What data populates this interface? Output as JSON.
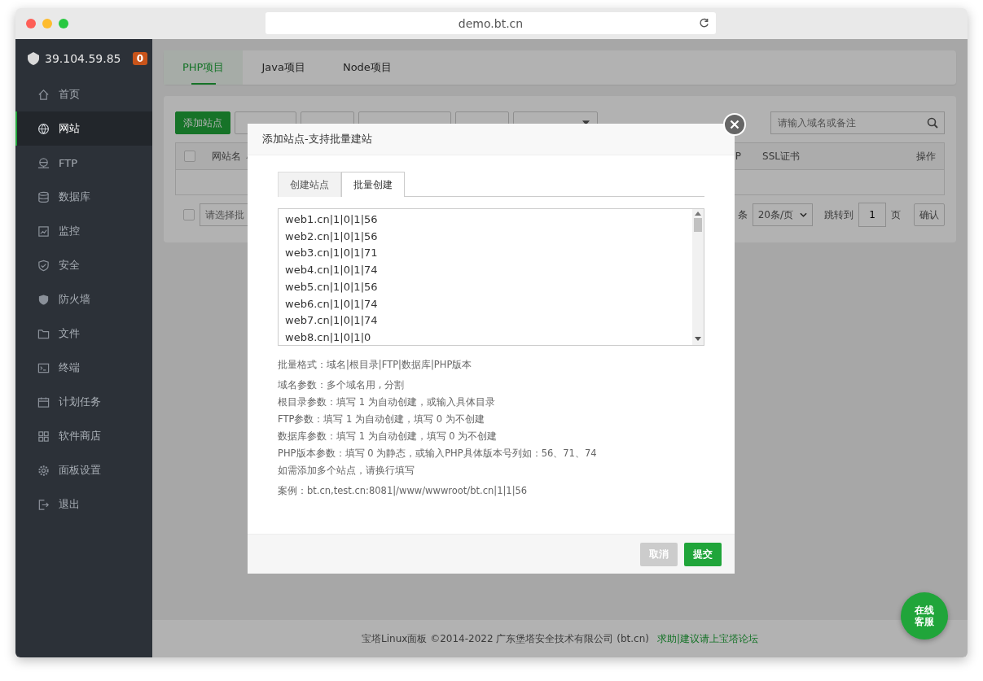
{
  "browser": {
    "address": "demo.bt.cn"
  },
  "sidebar": {
    "server": "39.104.59.85",
    "badge": "0",
    "items": [
      {
        "label": "首页",
        "selected": false
      },
      {
        "label": "网站",
        "selected": true
      },
      {
        "label": "FTP",
        "selected": false
      },
      {
        "label": "数据库",
        "selected": false
      },
      {
        "label": "监控",
        "selected": false
      },
      {
        "label": "安全",
        "selected": false
      },
      {
        "label": "防火墙",
        "selected": false
      },
      {
        "label": "文件",
        "selected": false
      },
      {
        "label": "终端",
        "selected": false
      },
      {
        "label": "计划任务",
        "selected": false
      },
      {
        "label": "软件商店",
        "selected": false
      },
      {
        "label": "面板设置",
        "selected": false
      },
      {
        "label": "退出",
        "selected": false
      }
    ]
  },
  "project_tabs": [
    {
      "label": "PHP项目",
      "selected": true
    },
    {
      "label": "Java项目",
      "selected": false
    },
    {
      "label": "Node项目",
      "selected": false
    }
  ],
  "toolbar": {
    "buttons": [
      {
        "label": "添加站点",
        "kind": "primary"
      },
      {
        "kind": "default"
      },
      {
        "kind": "default"
      },
      {
        "kind": "default"
      },
      {
        "kind": "default"
      },
      {
        "kind": "dropdown"
      }
    ],
    "search_placeholder": "请输入域名或备注"
  },
  "table": {
    "select_all_checked": false,
    "columns": [
      "网站名",
      "P",
      "SSL证书",
      "操作"
    ]
  },
  "pagination": {
    "checked": false,
    "batch_placeholder": "请选择批",
    "count_suffix": "条",
    "page_size": "20条/页",
    "jump_label": "跳转到",
    "page": "1",
    "page_unit": "页",
    "confirm": "确认"
  },
  "footer": {
    "copyright": "宝塔Linux面板 ©2014-2022 广东堡塔安全技术有限公司 (bt.cn)",
    "link": "求助|建议请上宝塔论坛"
  },
  "chat_button": "在线客服",
  "dialog": {
    "title": "添加站点-支持批量建站",
    "tabs": [
      {
        "label": "创建站点",
        "selected": false
      },
      {
        "label": "批量创建",
        "selected": true
      }
    ],
    "lines": [
      "web1.cn|1|0|1|56",
      "web2.cn|1|0|1|56",
      "web3.cn|1|0|1|71",
      "web4.cn|1|0|1|74",
      "web5.cn|1|0|1|56",
      "web6.cn|1|0|1|74",
      "web7.cn|1|0|1|74",
      "web8.cn|1|0|1|0"
    ],
    "format": "批量格式：域名|根目录|FTP|数据库|PHP版本",
    "notes": [
      "域名参数：多个域名用 , 分割",
      "根目录参数：填写 1 为自动创建，或输入具体目录",
      "FTP参数：填写 1 为自动创建，填写 0 为不创建",
      "数据库参数：填写 1 为自动创建，填写 0 为不创建",
      "PHP版本参数：填写 0 为静态，或输入PHP具体版本号列如：56、71、74",
      "如需添加多个站点，请换行填写"
    ],
    "example": "案例：bt.cn,test.cn:8081|/www/wwwroot/bt.cn|1|1|56",
    "buttons": [
      {
        "label": "取消",
        "disabled": true
      },
      {
        "label": "提交",
        "disabled": false
      }
    ]
  }
}
